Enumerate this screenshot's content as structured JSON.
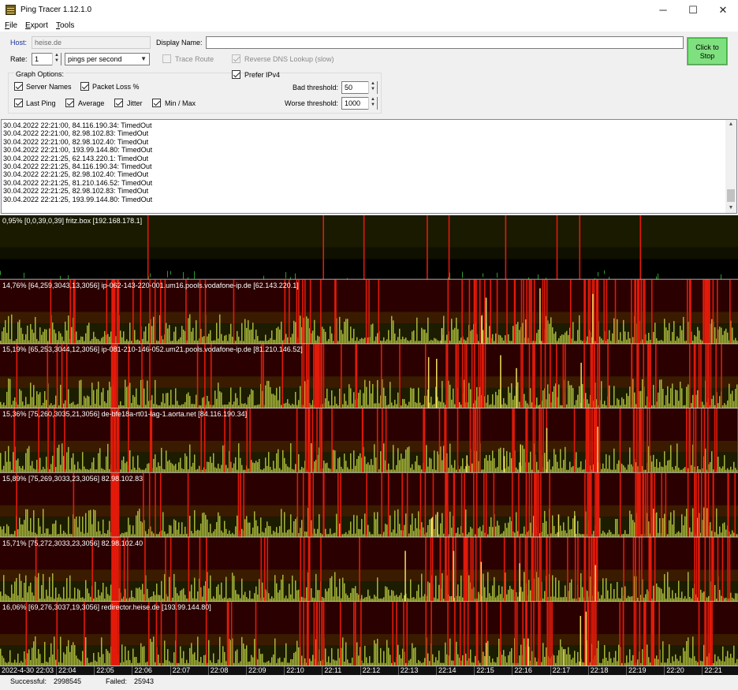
{
  "window": {
    "title": "Ping Tracer 1.12.1.0",
    "minimize": "─",
    "maximize": "☐",
    "close": "✕"
  },
  "menu": [
    {
      "u": "F",
      "rest": "ile"
    },
    {
      "u": "E",
      "rest": "xport"
    },
    {
      "u": "T",
      "rest": "ools"
    }
  ],
  "form": {
    "host_label": "Host:",
    "host_value": "heise.de",
    "display_name_label": "Display Name:",
    "display_name_value": "",
    "rate_label": "Rate:",
    "rate_value": "1",
    "rate_unit": "pings per second",
    "trace_route": "Trace Route",
    "reverse_dns": "Reverse DNS Lookup (slow)",
    "prefer_ipv4": "Prefer IPv4",
    "graph_options": "Graph Options:",
    "server_names": "Server Names",
    "packet_loss": "Packet Loss %",
    "last_ping": "Last Ping",
    "average": "Average",
    "jitter": "Jitter",
    "min_max": "Min / Max",
    "bad_threshold_label": "Bad threshold:",
    "bad_threshold_value": "50",
    "worse_threshold_label": "Worse threshold:",
    "worse_threshold_value": "1000",
    "stop_button": "Click to Stop"
  },
  "log": [
    "30.04.2022 22:21:00, 84.116.190.34: TimedOut",
    "30.04.2022 22:21:00, 82.98.102.83: TimedOut",
    "30.04.2022 22:21:00, 82.98.102.40: TimedOut",
    "30.04.2022 22:21:00, 193.99.144.80: TimedOut",
    "30.04.2022 22:21:25, 62.143.220.1: TimedOut",
    "30.04.2022 22:21:25, 84.116.190.34: TimedOut",
    "30.04.2022 22:21:25, 82.98.102.40: TimedOut",
    "30.04.2022 22:21:25, 81.210.146.52: TimedOut",
    "30.04.2022 22:21:25, 82.98.102.83: TimedOut",
    "30.04.2022 22:21:25, 193.99.144.80: TimedOut"
  ],
  "graphs": [
    {
      "label": "0,95% [0,0,39,0,39] fritz.box [192.168.178.1]"
    },
    {
      "label": "14,76% [64,259,3043,13,3056] ip-062-143-220-001.um16.pools.vodafone-ip.de [62.143.220.1]"
    },
    {
      "label": "15,19% [65,253,3044,12,3056] ip-081-210-146-052.um21.pools.vodafone-ip.de [81.210.146.52]"
    },
    {
      "label": "15,36% [75,260,3035,21,3056] de-bfe18a-rt01-lag-1.aorta.net [84.116.190.34]"
    },
    {
      "label": "15,89% [75,269,3033,23,3056] 82.98.102.83"
    },
    {
      "label": "15,71% [75,272,3033,23,3056] 82.98.102.40"
    },
    {
      "label": "16,06% [69,276,3037,19,3056] redirector.heise.de [193.99.144.80]"
    }
  ],
  "time_axis": [
    "2022-4-30 22:03",
    "22:04",
    "22:05",
    "22:06",
    "22:07",
    "22:08",
    "22:09",
    "22:10",
    "22:11",
    "22:12",
    "22:13",
    "22:14",
    "22:15",
    "22:16",
    "22:17",
    "22:18",
    "22:19",
    "22:20",
    "22:21"
  ],
  "status": {
    "successful_label": "Successful:",
    "successful_value": "2998545",
    "failed_label": "Failed:",
    "failed_value": "25943"
  },
  "colors": {
    "bad_band": "#3a1b00",
    "worse_band": "#2b0000",
    "ok_band": "#1c1c00",
    "timeout": "#e21a0a",
    "ping_bar": "#a6b63a",
    "spike": "#f0e060",
    "router_ping": "#2c9a2c"
  }
}
